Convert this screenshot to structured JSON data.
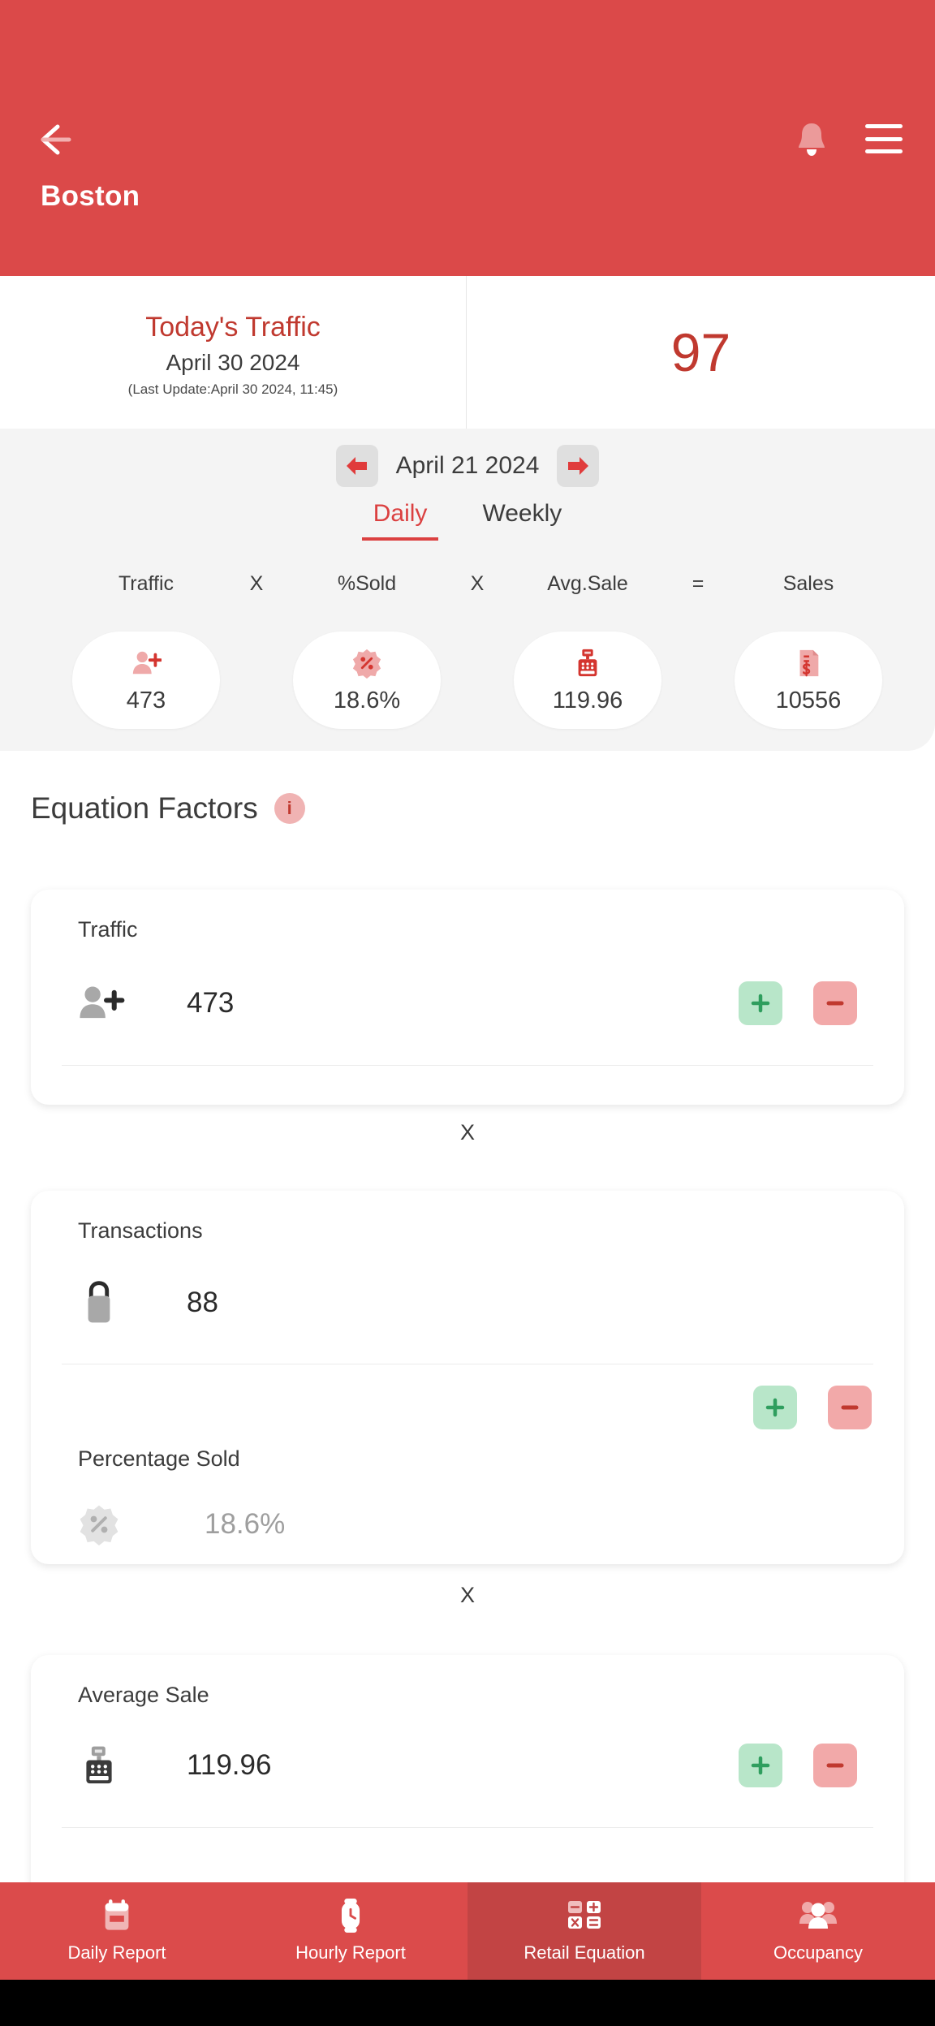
{
  "header": {
    "title": "Boston",
    "back_icon": "back-arrow-icon",
    "bell_icon": "bell-icon",
    "menu_icon": "hamburger-menu-icon",
    "bg_color": "#db4949"
  },
  "today_traffic": {
    "title": "Today's Traffic",
    "date": "April 30 2024",
    "last_update": "(Last Update:April 30 2024, 11:45)",
    "value": "97",
    "accent_color": "#c0392f"
  },
  "date_nav": {
    "prev_icon": "arrow-left-icon",
    "next_icon": "arrow-right-icon",
    "current_date": "April 21 2024"
  },
  "period_tabs": {
    "items": [
      {
        "label": "Daily",
        "active": true
      },
      {
        "label": "Weekly",
        "active": false
      }
    ]
  },
  "equation_summary": {
    "terms": [
      {
        "label": "Traffic",
        "value": "473",
        "icon": "person-add-icon"
      },
      {
        "label": "%Sold",
        "value": "18.6%",
        "icon": "percent-badge-icon"
      },
      {
        "label": "Avg.Sale",
        "value": "119.96",
        "icon": "cash-register-icon"
      },
      {
        "label": "Sales",
        "value": "10556",
        "icon": "receipt-dollar-icon"
      }
    ],
    "operators": [
      "X",
      "X",
      "="
    ]
  },
  "equation_factors": {
    "title": "Equation Factors",
    "info_icon": "info-icon",
    "info_glyph": "i",
    "separators": [
      "X",
      "X"
    ],
    "cards": [
      {
        "label": "Traffic",
        "value": "473",
        "icon": "person-add-icon",
        "muted": false,
        "plus_label": "+",
        "minus_label": "−"
      },
      {
        "label": "Transactions",
        "value": "88",
        "icon": "shopping-bag-icon",
        "muted": false,
        "plus_label": "+",
        "minus_label": "−"
      },
      {
        "label": "Percentage Sold",
        "value": "18.6%",
        "icon": "percent-badge-icon",
        "muted": true
      },
      {
        "label": "Average Sale",
        "value": "119.96",
        "icon": "cash-register-icon",
        "muted": false,
        "plus_label": "+",
        "minus_label": "−"
      }
    ]
  },
  "bottom_nav": {
    "items": [
      {
        "label": "Daily Report",
        "icon": "calendar-icon",
        "selected": false
      },
      {
        "label": "Hourly Report",
        "icon": "clock-icon",
        "selected": false
      },
      {
        "label": "Retail Equation",
        "icon": "calculator-icon",
        "selected": true
      },
      {
        "label": "Occupancy",
        "icon": "people-icon",
        "selected": false
      }
    ],
    "bg_color": "#db4b4b",
    "selected_bg_color": "#c24444"
  },
  "colors": {
    "plus_button": "#b8e6c9",
    "minus_button": "#f2a9a9",
    "panel_bg": "#f4f4f4"
  }
}
